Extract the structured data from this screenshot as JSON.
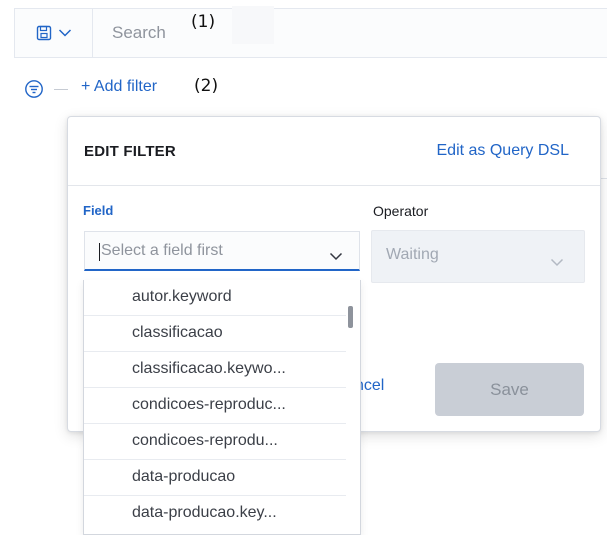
{
  "query_bar": {
    "search_placeholder": "Search",
    "saved_queries_icon": "save-icon",
    "menu_chevron_icon": "chevron-down-icon"
  },
  "annotations": {
    "label_1": "(1)",
    "label_2": "(2)"
  },
  "filter_bar": {
    "filter_icon": "filter-icon",
    "add_filter_label": "+ Add filter"
  },
  "edit_filter": {
    "title": "EDIT FILTER",
    "edit_dsl_label": "Edit as Query DSL",
    "field_label": "Field",
    "field_placeholder": "Select a field first",
    "operator_label": "Operator",
    "operator_value": "Waiting",
    "cancel_label": "ncel",
    "save_label": "Save"
  },
  "field_options": [
    "autor.keyword",
    "classificacao",
    "classificacao.keywo...",
    "condicoes-reproduc...",
    "condicoes-reprodu...",
    "data-producao",
    "data-producao.key..."
  ],
  "colors": {
    "link_blue": "#2165c7",
    "muted_text": "#8f949d",
    "disabled_button": "#c9ced6"
  }
}
